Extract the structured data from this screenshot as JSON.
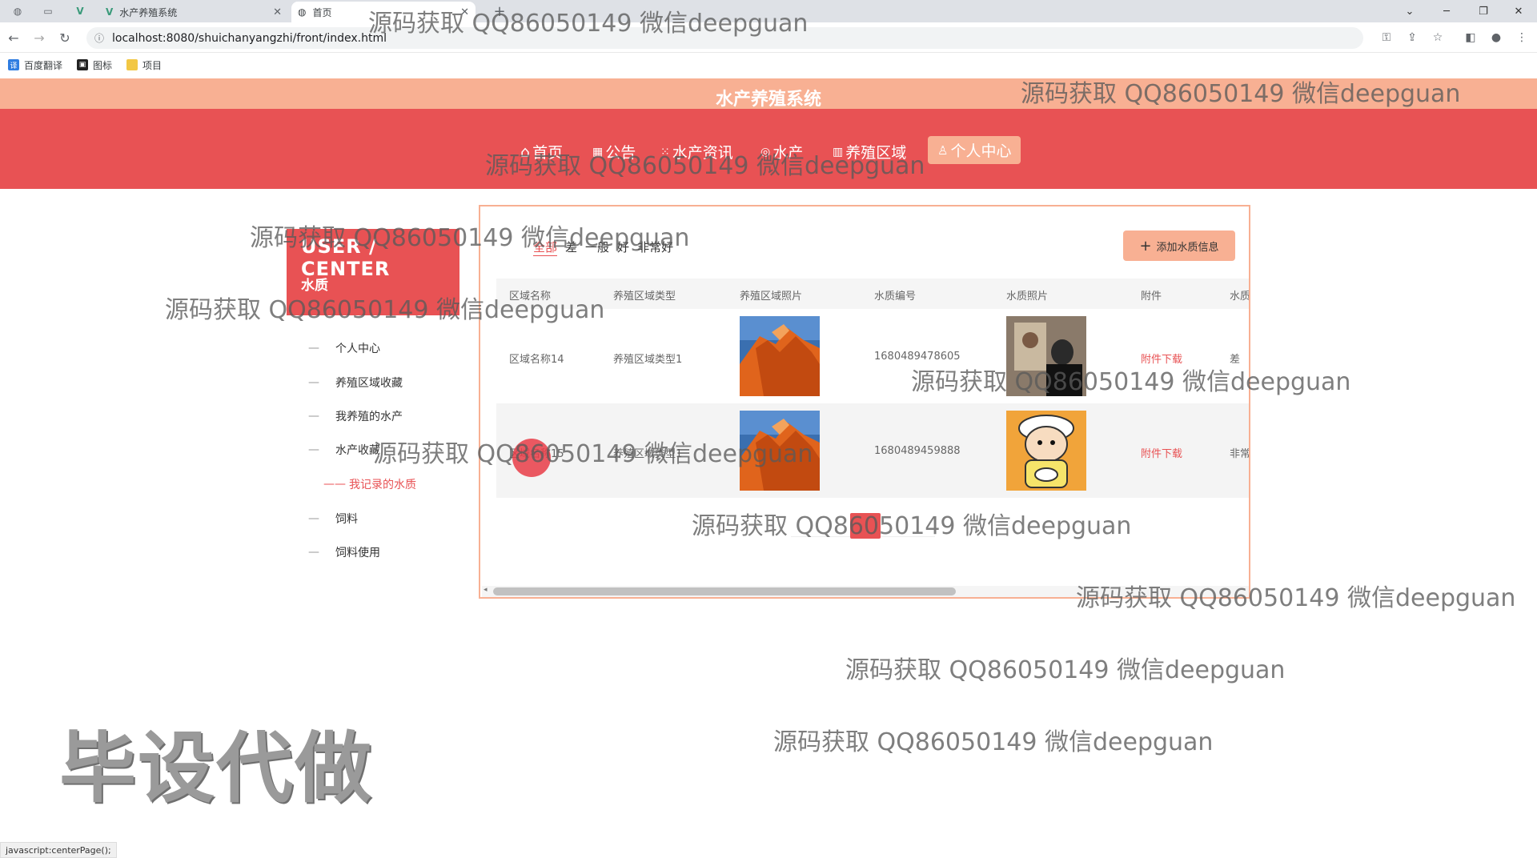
{
  "browser": {
    "tabs": [
      {
        "title": "水产养殖系统",
        "icon": "vue-icon"
      },
      {
        "title": "首页",
        "icon": "globe-icon"
      }
    ],
    "url": "localhost:8080/shuichanyangzhi/front/index.html",
    "bookmarks": [
      {
        "label": "百度翻译"
      },
      {
        "label": "图标"
      },
      {
        "label": "项目"
      }
    ],
    "status_text": "javascript:centerPage();"
  },
  "site": {
    "title": "水产养殖系统",
    "nav": [
      {
        "label": "首页",
        "icon": "home-icon"
      },
      {
        "label": "公告",
        "icon": "notice-icon"
      },
      {
        "label": "水产资讯",
        "icon": "news-icon"
      },
      {
        "label": "水产",
        "icon": "fish-icon"
      },
      {
        "label": "养殖区域",
        "icon": "area-icon"
      },
      {
        "label": "个人中心",
        "icon": "user-icon",
        "active": true
      }
    ]
  },
  "sidebar": {
    "heading": "USER / CENTER",
    "subheading": "水质",
    "items": [
      {
        "label": "个人中心"
      },
      {
        "label": "养殖区域收藏"
      },
      {
        "label": "我养殖的水产"
      },
      {
        "label": "水产收藏"
      },
      {
        "label": "我记录的水质",
        "active": true
      },
      {
        "label": "饲料"
      },
      {
        "label": "饲料使用"
      }
    ]
  },
  "content": {
    "filters": [
      "全部",
      "差",
      "一般",
      "好",
      "非常好"
    ],
    "active_filter": "全部",
    "add_button": "添加水质信息",
    "columns": [
      "区域名称",
      "养殖区域类型",
      "养殖区域照片",
      "水质编号",
      "水质照片",
      "附件",
      "水质"
    ],
    "rows": [
      {
        "area_name": "区域名称14",
        "area_type": "养殖区域类型1",
        "water_id": "1680489478605",
        "attachment": "附件下载",
        "quality": "差"
      },
      {
        "area_name": "区域名称15",
        "area_type": "养殖区域类型1",
        "water_id": "1680489459888",
        "attachment": "附件下载",
        "quality": "非常"
      }
    ]
  },
  "watermarks": {
    "text": "源码获取 QQ86050149 微信deepguan",
    "big": "毕设代做"
  },
  "colors": {
    "primary": "#e85254",
    "secondary": "#f8b093"
  }
}
